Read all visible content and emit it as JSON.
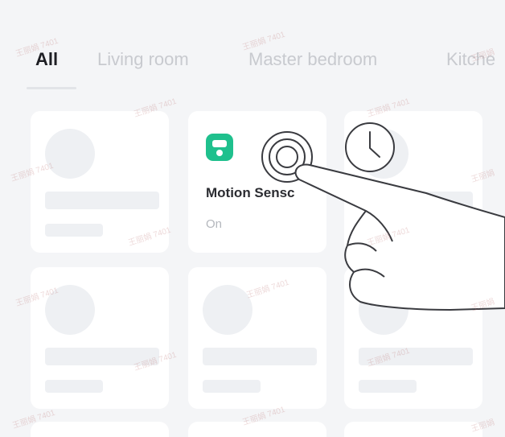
{
  "tabs": [
    {
      "label": "All",
      "active": true
    },
    {
      "label": "Living room",
      "active": false
    },
    {
      "label": "Master bedroom",
      "active": false
    },
    {
      "label": "Kitche",
      "active": false
    }
  ],
  "device_card": {
    "icon": "motion-sensor-icon",
    "icon_color": "#1fc08d",
    "name": "Motion Sensc",
    "status": "On"
  },
  "colors": {
    "background": "#f4f5f7",
    "card": "#ffffff",
    "placeholder": "#eef0f3",
    "accent": "#1fc08d"
  },
  "icons": [
    "motion-sensor-icon",
    "touch-ripple-icon",
    "clock-icon",
    "pointing-hand-icon"
  ]
}
